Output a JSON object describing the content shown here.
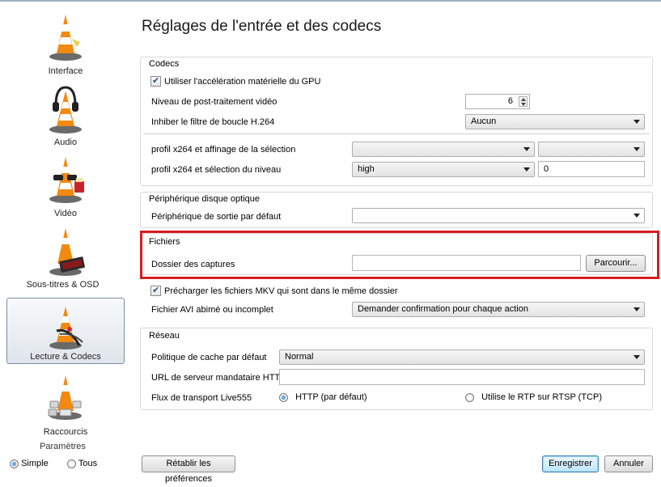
{
  "page_title": "Réglages de l'entrée et des codecs",
  "sidebar": {
    "items": [
      {
        "label": "Interface",
        "icon": "vlc-cone-interface-icon"
      },
      {
        "label": "Audio",
        "icon": "vlc-cone-headphones-icon"
      },
      {
        "label": "Vidéo",
        "icon": "vlc-cone-glasses-icon"
      },
      {
        "label": "Sous-titres & OSD",
        "icon": "vlc-cone-subtitles-icon"
      },
      {
        "label": "Lecture & Codecs",
        "icon": "vlc-cone-cables-icon",
        "selected": true
      },
      {
        "label": "Raccourcis",
        "icon": "vlc-cone-hotkeys-icon"
      }
    ],
    "params_title": "Paramètres",
    "mode_simple": "Simple",
    "mode_all": "Tous",
    "selected_mode": "Simple"
  },
  "codecs": {
    "title": "Codecs",
    "gpu_label": "Utiliser l'accélération matérielle du GPU",
    "gpu_checked": true,
    "postproc_label": "Niveau de post-traitement vidéo",
    "postproc_value": "6",
    "loopfilter_label": "Inhiber le filtre de boucle H.264",
    "loopfilter_value": "Aucun",
    "x264_tune_label": "profil x264 et affinage de la sélection",
    "x264_tune_value1": "",
    "x264_tune_value2": "",
    "x264_level_label": "profil x264 et sélection du niveau",
    "x264_level_value": "high",
    "x264_level_number": "0"
  },
  "optical": {
    "title": "Périphérique disque optique",
    "default_device_label": "Périphérique de sortie par défaut",
    "default_device_value": ""
  },
  "files": {
    "title": "Fichiers",
    "snapshot_dir_label": "Dossier des captures",
    "snapshot_dir_value": "",
    "browse_label": "Parcourir..."
  },
  "mkv": {
    "preload_label": "Précharger les fichiers MKV qui sont dans le même dossier",
    "preload_checked": true,
    "avi_label": "Fichier AVI abimé ou incomplet",
    "avi_value": "Demander confirmation pour chaque action"
  },
  "network": {
    "title": "Réseau",
    "cache_label": "Politique de cache par défaut",
    "cache_value": "Normal",
    "proxy_label": "URL de serveur mandataire HTTP",
    "proxy_value": "",
    "live555_label": "Flux de transport Live555",
    "http_option": "HTTP (par défaut)",
    "rtp_option": "Utilise le RTP sur RTSP (TCP)",
    "selected_transport": "HTTP (par défaut)"
  },
  "footer": {
    "reset_label": "Rétablir les préférences",
    "save_label": "Enregistrer",
    "cancel_label": "Annuler"
  },
  "colors": {
    "highlight_box": "#d61f1f",
    "selected_category_border": "#7a8ea5",
    "default_button_border": "#3c7fb1"
  }
}
